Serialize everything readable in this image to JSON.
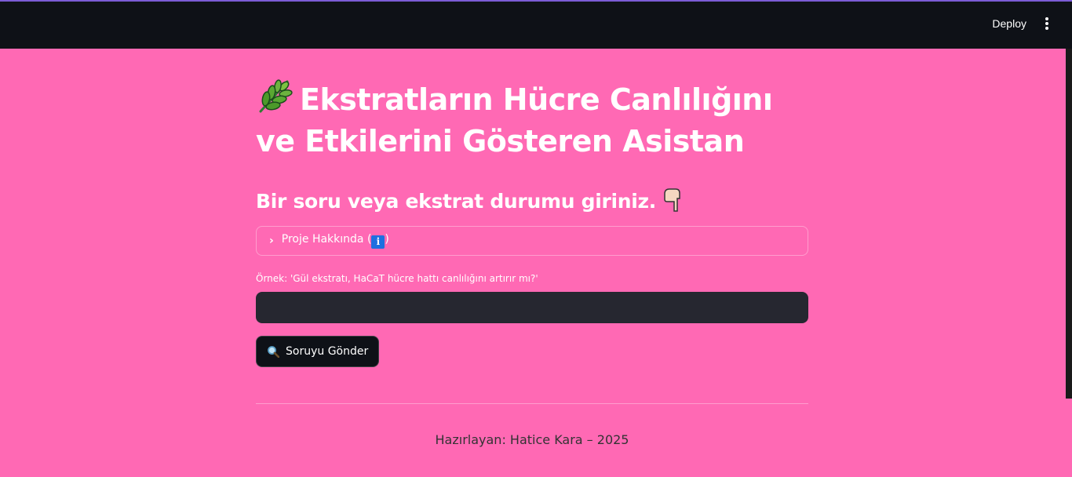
{
  "header": {
    "deploy_label": "Deploy",
    "menu_icon": "more-vertical-icon"
  },
  "main": {
    "title_icon": "herb-icon",
    "title": "Ekstratların Hücre Canlılığını ve Etkilerini Gösteren Asistan",
    "subtitle": "Bir soru veya ekstrat durumu giriniz.",
    "subtitle_icon": "pointing-down-icon",
    "expander": {
      "label_prefix": "Proje Hakkında (",
      "info_icon_text": "i",
      "label_suffix": ")"
    },
    "input": {
      "label": "Örnek: 'Gül ekstratı, HaCaT hücre hattı canlılığını artırır mı?'",
      "value": "",
      "placeholder": ""
    },
    "send_button": {
      "label": "Soruyu Gönder",
      "icon": "magnifier-icon"
    },
    "footer_text": "Hazırlayan: Hatice Kara – 2025"
  },
  "colors": {
    "background": "#ff69b4",
    "topbar": "#0e1117",
    "input_bg": "#262730",
    "accent_line": "#7b5cd6"
  }
}
